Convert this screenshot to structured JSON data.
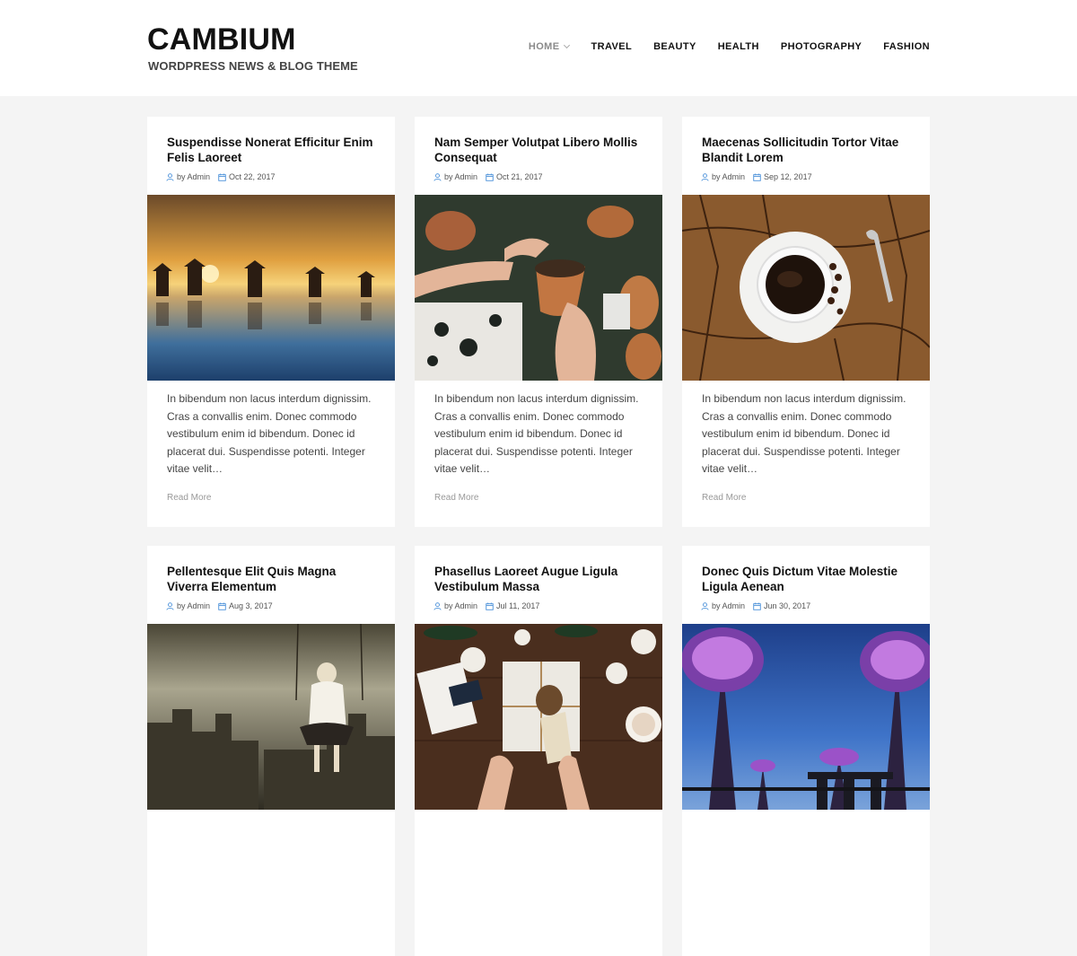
{
  "site": {
    "title": "CAMBIUM",
    "tagline": "WORDPRESS NEWS & BLOG THEME"
  },
  "nav": {
    "items": [
      {
        "label": "HOME"
      },
      {
        "label": "TRAVEL"
      },
      {
        "label": "BEAUTY"
      },
      {
        "label": "HEALTH"
      },
      {
        "label": "PHOTOGRAPHY"
      },
      {
        "label": "FASHION"
      }
    ]
  },
  "colors": {
    "accent": "#4a90d9",
    "muted": "#8a8a8a"
  },
  "posts": [
    {
      "title": "Suspendisse Nonerat Efficitur Enim Felis Laoreet",
      "author": "by Admin",
      "date": "Oct 22, 2017",
      "image": "sunset-salt-field-workers",
      "excerpt": "In bibendum non lacus interdum dignissim. Cras a convallis enim. Donec commodo vestibulum enim id bibendum. Donec id placerat dui. Suspendisse potenti. Integer vitae velit…",
      "read_more": "Read More"
    },
    {
      "title": "Nam Semper Volutpat Libero Mollis Consequat",
      "author": "by Admin",
      "date": "Oct 21, 2017",
      "image": "hands-potting-plants",
      "excerpt": "In bibendum non lacus interdum dignissim. Cras a convallis enim. Donec commodo vestibulum enim id bibendum. Donec id placerat dui. Suspendisse potenti. Integer vitae velit…",
      "read_more": "Read More"
    },
    {
      "title": "Maecenas Sollicitudin Tortor Vitae Blandit Lorem",
      "author": "by Admin",
      "date": "Sep 12, 2017",
      "image": "coffee-cup-on-wood",
      "excerpt": "In bibendum non lacus interdum dignissim. Cras a convallis enim. Donec commodo vestibulum enim id bibendum. Donec id placerat dui. Suspendisse potenti. Integer vitae velit…",
      "read_more": "Read More"
    },
    {
      "title": "Pellentesque Elit Quis Magna Viverra Elementum",
      "author": "by Admin",
      "date": "Aug 3, 2017",
      "image": "child-on-swing-over-city",
      "excerpt": "",
      "read_more": ""
    },
    {
      "title": "Phasellus Laoreet Augue Ligula Vestibulum Massa",
      "author": "by Admin",
      "date": "Jul 11, 2017",
      "image": "holiday-gift-pinecones",
      "excerpt": "",
      "read_more": ""
    },
    {
      "title": "Donec Quis Dictum Vitae Molestie Ligula Aenean",
      "author": "by Admin",
      "date": "Jun 30, 2017",
      "image": "supertree-grove-night",
      "excerpt": "",
      "read_more": ""
    }
  ]
}
